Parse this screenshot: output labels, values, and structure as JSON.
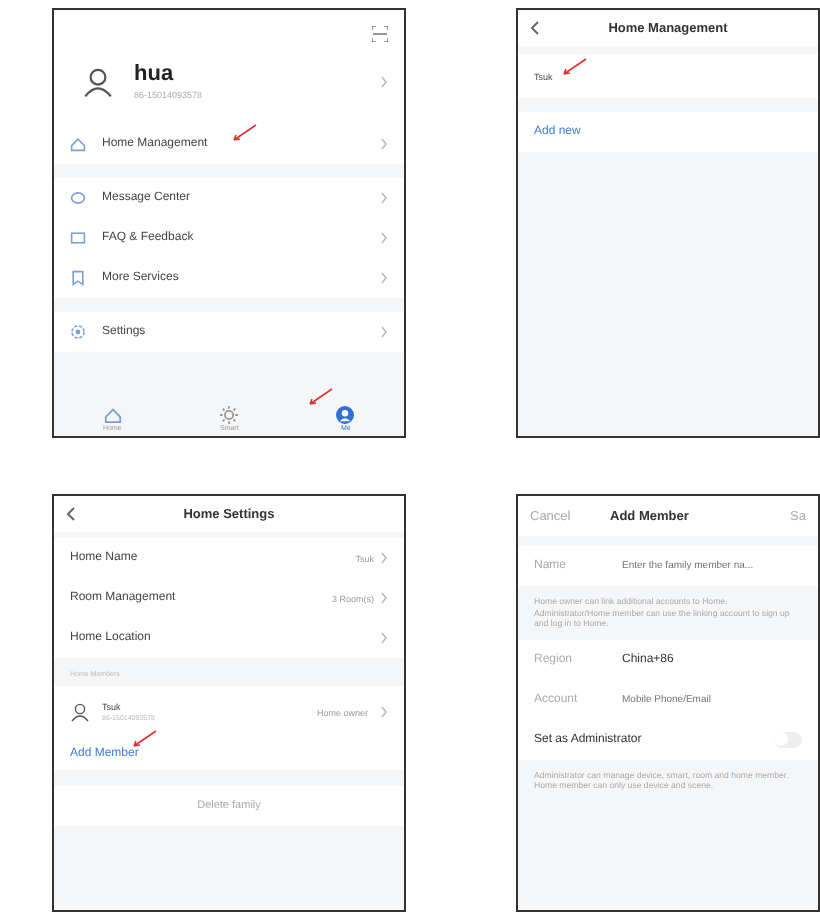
{
  "screens": [
    {
      "kind": "me",
      "user": {
        "name": "hua",
        "phone": "86-15014093578"
      },
      "menu": [
        {
          "label": "Home Management",
          "pointed": true
        },
        {
          "label": "Message Center",
          "pointed": false
        },
        {
          "label": "FAQ & Feedback",
          "pointed": false
        },
        {
          "label": "More Services",
          "pointed": false
        },
        {
          "label": "Settings",
          "pointed": false
        }
      ],
      "tabs": [
        {
          "label": "Home",
          "selected": false,
          "pointed": false
        },
        {
          "label": "Smart",
          "selected": false,
          "pointed": false
        },
        {
          "label": "Me",
          "selected": true,
          "pointed": true
        }
      ]
    },
    {
      "kind": "homes",
      "title": "Home Management",
      "homes": [
        {
          "name": "Tsuk",
          "pointed": true
        }
      ],
      "add": "Add new"
    },
    {
      "kind": "settings",
      "title": "Home Settings",
      "rows": [
        {
          "label": "Home Name",
          "value": "Tsuk"
        },
        {
          "label": "Room Management",
          "value": "3 Room(s)"
        },
        {
          "label": "Home Location"
        }
      ],
      "section": "Home Members",
      "members": [
        {
          "name": "Tsuk",
          "phone": "86-15014093578",
          "role": "Home owner"
        }
      ],
      "add_member": {
        "label": "Add Member",
        "pointed": true
      },
      "delete": "Delete family"
    },
    {
      "kind": "form",
      "cancel": "Cancel",
      "title": "Add Member",
      "save": "Sa",
      "name": {
        "label": "Name",
        "placeholder": "Enter the family member na..."
      },
      "note": "Home owner can link additional accounts to Home. Administrator/Home member can use the linking account to sign up and log in to Home.",
      "region": {
        "label": "Region",
        "value": "China+86"
      },
      "account": {
        "label": "Account",
        "placeholder": "Mobile Phone/Email"
      },
      "admin": {
        "label": "Set as Administrator",
        "on": false
      },
      "admin_note": "Administrator can manage device, smart, room and home member. Home member can only use device and scene."
    }
  ]
}
